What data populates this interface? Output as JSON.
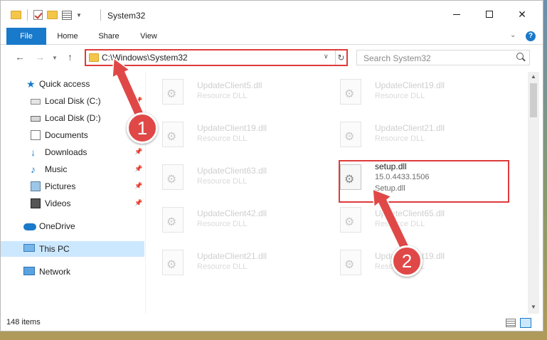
{
  "window": {
    "title": "System32"
  },
  "ribbon": {
    "tabs": [
      "File",
      "Home",
      "Share",
      "View"
    ]
  },
  "navigation": {
    "address_path": "C:\\Windows\\System32",
    "search_placeholder": "Search System32"
  },
  "sidebar": {
    "items": [
      {
        "label": "Quick access",
        "icon": "star-icon",
        "pinned": false
      },
      {
        "label": "Local Disk (C:)",
        "icon": "drive-icon",
        "pinned": true
      },
      {
        "label": "Local Disk (D:)",
        "icon": "drive-icon",
        "pinned": false
      },
      {
        "label": "Documents",
        "icon": "documents-icon",
        "pinned": true
      },
      {
        "label": "Downloads",
        "icon": "downloads-icon",
        "pinned": true
      },
      {
        "label": "Music",
        "icon": "music-icon",
        "pinned": true
      },
      {
        "label": "Pictures",
        "icon": "pictures-icon",
        "pinned": true
      },
      {
        "label": "Videos",
        "icon": "videos-icon",
        "pinned": true
      },
      {
        "label": "OneDrive",
        "icon": "cloud-icon",
        "pinned": false
      },
      {
        "label": "This PC",
        "icon": "computer-icon",
        "pinned": false,
        "selected": true
      },
      {
        "label": "Network",
        "icon": "network-icon",
        "pinned": false
      }
    ]
  },
  "files": [
    {
      "name": "UpdateClient5.dll",
      "type": "Resource DLL"
    },
    {
      "name": "UpdateClient19.dll",
      "type": "Resource DLL"
    },
    {
      "name": "UpdateClient19.dll",
      "type": "Resource DLL"
    },
    {
      "name": "UpdateClient21.dll",
      "type": "Resource DLL"
    },
    {
      "name": "UpdateClient63.dll",
      "type": "Resource DLL"
    },
    {
      "name": "setup.dll",
      "version": "15.0.4433.1506",
      "description": "Setup.dll",
      "highlighted": true
    },
    {
      "name": "UpdateClient42.dll",
      "type": "Resource DLL"
    },
    {
      "name": "UpdateClient65.dll",
      "type": "Resource DLL"
    },
    {
      "name": "UpdateClient21.dll",
      "type": "Resource DLL"
    },
    {
      "name": "UpdateClient19.dll",
      "type": "Resource DLL"
    }
  ],
  "status": {
    "item_count": "148 items"
  },
  "annotations": {
    "step1": "1",
    "step2": "2",
    "color": "#e04848"
  }
}
